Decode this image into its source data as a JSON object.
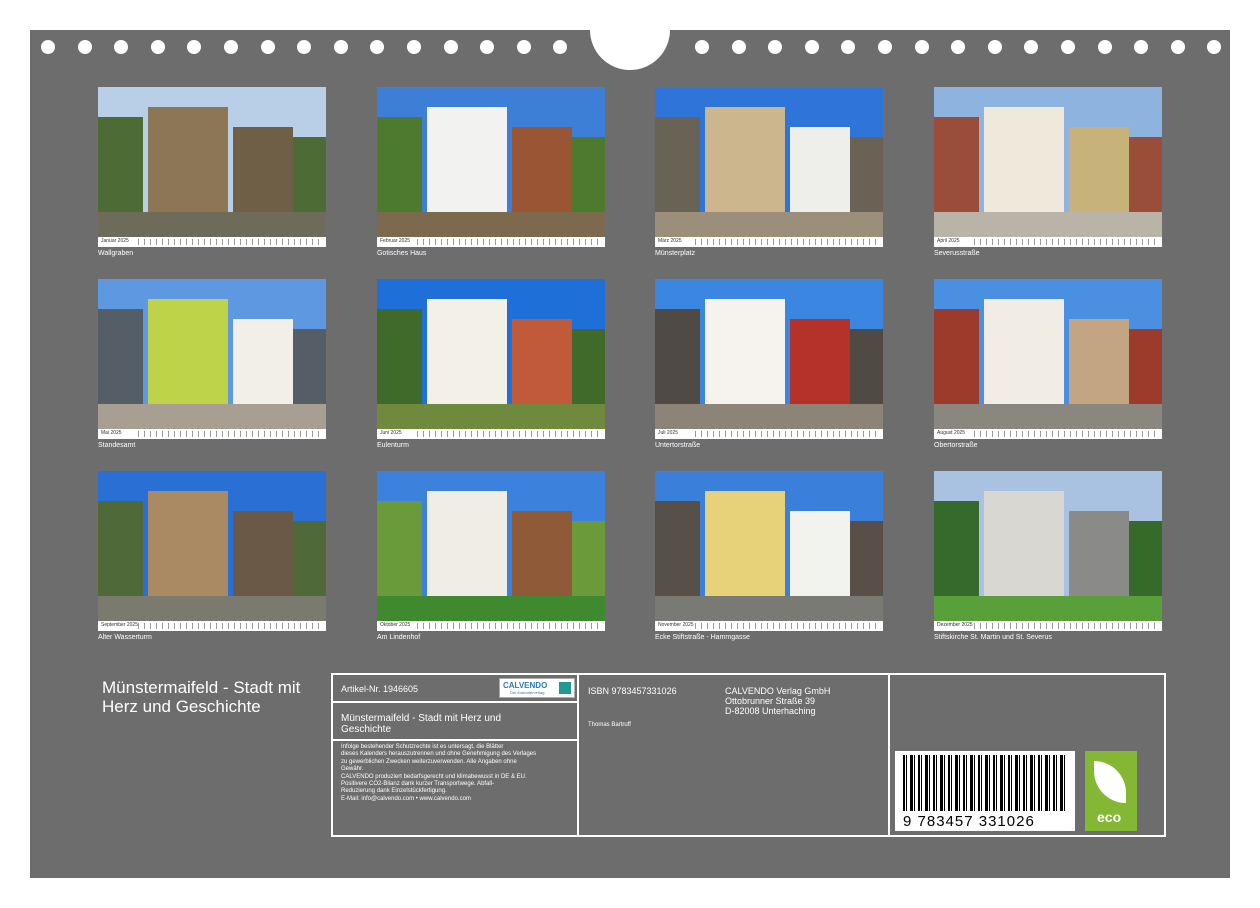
{
  "tiles": [
    {
      "caption": "Wallgraben",
      "month": "Januar 2025",
      "palette": {
        "sky": "#b9cfe8",
        "ground": "#6f6b5a",
        "b1": "#8c7656",
        "b2": "#6e5f46",
        "b3": "#4d6b34"
      }
    },
    {
      "caption": "Gotisches Haus",
      "month": "Februar 2025",
      "palette": {
        "sky": "#3d7fd6",
        "ground": "#7b6a4d",
        "b1": "#f2f2f0",
        "b2": "#9a5535",
        "b3": "#4d7a2e"
      }
    },
    {
      "caption": "Münsterplatz",
      "month": "März 2025",
      "palette": {
        "sky": "#2f74d8",
        "ground": "#9b8f7c",
        "b1": "#cbb68e",
        "b2": "#eeeeea",
        "b3": "#6b6256"
      }
    },
    {
      "caption": "Severusstraße",
      "month": "April 2025",
      "palette": {
        "sky": "#8fb3df",
        "ground": "#b9b3a8",
        "b1": "#efe9dc",
        "b2": "#c7b27a",
        "b3": "#9a4e3a"
      }
    },
    {
      "caption": "Standesamt",
      "month": "Mai 2025",
      "palette": {
        "sky": "#5e98e0",
        "ground": "#a79f92",
        "b1": "#bfd34a",
        "b2": "#f1efe8",
        "b3": "#555d66"
      }
    },
    {
      "caption": "Eulenturm",
      "month": "Juni 2025",
      "palette": {
        "sky": "#1f6fd8",
        "ground": "#6f8a3c",
        "b1": "#f3f0e8",
        "b2": "#c05a3a",
        "b3": "#3f6a2a"
      }
    },
    {
      "caption": "Untertorstraße",
      "month": "Juli 2025",
      "palette": {
        "sky": "#3b86e0",
        "ground": "#8c8476",
        "b1": "#f6f3ee",
        "b2": "#b5322a",
        "b3": "#4f4a44"
      }
    },
    {
      "caption": "Obertorstraße",
      "month": "August 2025",
      "palette": {
        "sky": "#4b8fe0",
        "ground": "#8a8680",
        "b1": "#f1ede5",
        "b2": "#c3a483",
        "b3": "#9c3a2c"
      }
    },
    {
      "caption": "Alter Wasserturm",
      "month": "September 2025",
      "palette": {
        "sky": "#2a6fd4",
        "ground": "#7b7a6f",
        "b1": "#a98a62",
        "b2": "#6b5948",
        "b3": "#4f6a38"
      }
    },
    {
      "caption": "Am Lindenhof",
      "month": "Oktober 2025",
      "palette": {
        "sky": "#3c82dc",
        "ground": "#3f8a2f",
        "b1": "#f0ede6",
        "b2": "#8f5a38",
        "b3": "#6a9a3a"
      }
    },
    {
      "caption": "Ecke Stiftstraße - Hammgasse",
      "month": "November 2025",
      "palette": {
        "sky": "#3a80db",
        "ground": "#7a7a74",
        "b1": "#e7d27a",
        "b2": "#f2f2ee",
        "b3": "#585048"
      }
    },
    {
      "caption": "Stiftskirche St. Martin und St. Severus",
      "month": "Dezember 2025",
      "palette": {
        "sky": "#a9c2e2",
        "ground": "#5aa03a",
        "b1": "#d9d7d2",
        "b2": "#8a8a88",
        "b3": "#356a2a"
      }
    }
  ],
  "product_title": "Münstermaifeld - Stadt mit Herz und Geschichte",
  "info": {
    "article": "Artikel-Nr. 1946605",
    "logo_text": "CALVENDO",
    "logo_sub": "Der Kalenderverlag",
    "title": "Münstermaifeld - Stadt mit Herz und Geschichte",
    "legal_lines": [
      "Infolge bestehender Schutzrechte ist es untersagt, die Blätter",
      "dieses Kalenders herauszutrennen und ohne Genehmigung des Verlages",
      "zu gewerblichen Zwecken weiterzuverwenden. Alle Angaben ohne",
      "Gewähr.",
      "CALVENDO produziert bedarfsgerecht und klimabewusst in DE & EU.",
      "Positivere CO2-Bilanz dank kurzer Transportwege. Abfall-",
      "Reduzierung dank Einzelstückfertigung.",
      "E-Mail: info@calvendo.com • www.calvendo.com"
    ],
    "isbn": "ISBN 9783457331026",
    "author": "Thomas Bartruff",
    "publisher_lines": [
      "CALVENDO Verlag GmbH",
      "Ottobrunner Straße 39",
      "D-82008 Unterhaching"
    ],
    "barcode_number": "9 783457 331026",
    "eco_label": "eco"
  }
}
